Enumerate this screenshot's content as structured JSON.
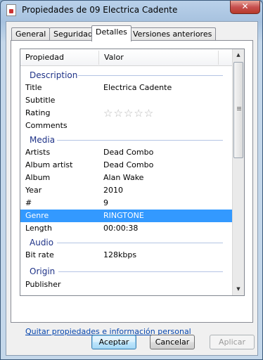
{
  "window": {
    "title": "Propiedades de 09 Electrica Cadente",
    "close_label": "✕"
  },
  "tabs": [
    {
      "label": "General"
    },
    {
      "label": "Seguridad"
    },
    {
      "label": "Detalles"
    },
    {
      "label": "Versiones anteriores"
    }
  ],
  "columns": {
    "property": "Propiedad",
    "value": "Valor"
  },
  "groups": {
    "description": "Description",
    "media": "Media",
    "audio": "Audio",
    "origin": "Origin"
  },
  "rows": {
    "title": {
      "key": "Title",
      "value": "Electrica Cadente"
    },
    "subtitle": {
      "key": "Subtitle",
      "value": ""
    },
    "rating": {
      "key": "Rating",
      "value": ""
    },
    "comments": {
      "key": "Comments",
      "value": ""
    },
    "artists": {
      "key": "Artists",
      "value": "Dead Combo"
    },
    "album_artist": {
      "key": "Album artist",
      "value": "Dead Combo"
    },
    "album": {
      "key": "Album",
      "value": "Alan Wake"
    },
    "year": {
      "key": "Year",
      "value": "2010"
    },
    "track": {
      "key": "#",
      "value": "9"
    },
    "genre": {
      "key": "Genre",
      "value": "RINGTONE"
    },
    "length": {
      "key": "Length",
      "value": "00:00:38"
    },
    "bitrate": {
      "key": "Bit rate",
      "value": "128kbps"
    },
    "publisher": {
      "key": "Publisher",
      "value": ""
    }
  },
  "rating_stars": 0,
  "rating_glyphs": "☆☆☆☆☆",
  "selected_row": "genre",
  "link_text": "Quitar propiedades e información personal",
  "buttons": {
    "accept": "Aceptar",
    "cancel": "Cancelar",
    "apply": "Aplicar"
  },
  "colors": {
    "selection": "#3399ff",
    "group_text": "#1e3287",
    "link": "#0645ad"
  }
}
